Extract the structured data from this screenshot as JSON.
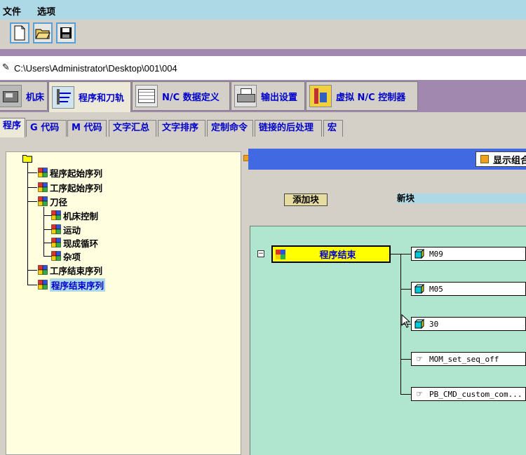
{
  "menubar": {
    "items": [
      "文件",
      "选项"
    ]
  },
  "toolbar": {
    "buttons": [
      "new-file-icon",
      "open-folder-icon",
      "save-icon"
    ]
  },
  "path": "C:\\Users\\Administrator\\Desktop\\001\\004",
  "main_tabs": [
    {
      "label": "机床",
      "icon": "machine-icon"
    },
    {
      "label": "程序和刀轨",
      "icon": "program-toolpath-icon",
      "active": true
    },
    {
      "label": "N/C 数据定义",
      "icon": "nc-data-icon"
    },
    {
      "label": "输出设置",
      "icon": "printer-icon"
    },
    {
      "label": "虚拟 N/C 控制器",
      "icon": "virtual-controller-icon"
    }
  ],
  "sub_tabs": [
    "程序",
    "G 代码",
    "M 代码",
    "文字汇总",
    "文字排序",
    "定制命令",
    "链接的后处理",
    "宏"
  ],
  "tree": {
    "root_icon": "folder-icon",
    "items": [
      "程序起始序列",
      "工序起始序列",
      "刀径",
      "机床控制",
      "运动",
      "现成循环",
      "杂项",
      "工序结束序列",
      "程序结束序列"
    ],
    "selected": "程序结束序列"
  },
  "right": {
    "show_combo_label": "显示组合",
    "add_block_label": "添加块",
    "new_block_label": "新块",
    "main_node_label": "程序结束",
    "children": [
      "M09",
      "M05",
      "30",
      "MOM_set_seq_off",
      "PB_CMD_custom_com..."
    ]
  },
  "colors": {
    "menubar": "#add8e6",
    "purple": "#a088ae",
    "canvas": "#b0e6d0",
    "node": "#ffff00",
    "blue": "#4169e1"
  }
}
